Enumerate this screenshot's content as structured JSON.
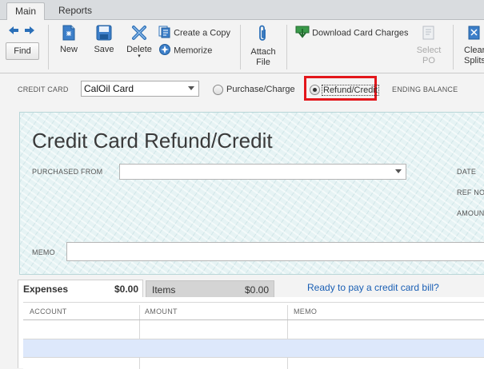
{
  "tabs": [
    {
      "label": "Main",
      "active": true
    },
    {
      "label": "Reports",
      "active": false
    }
  ],
  "toolbar": {
    "find": "Find",
    "new": "New",
    "save": "Save",
    "delete": "Delete",
    "create_copy": "Create a Copy",
    "memorize": "Memorize",
    "attach_line1": "Attach",
    "attach_line2": "File",
    "download": "Download Card Charges",
    "select_line1": "Select",
    "select_line2": "PO",
    "clear_line1": "Clear",
    "clear_line2": "Splits"
  },
  "header": {
    "credit_card_label": "CREDIT CARD",
    "credit_card_value": "CalOil Card",
    "radio_purchase": "Purchase/Charge",
    "radio_refund": "Refund/Credit",
    "selected_radio": "refund",
    "ending_balance_label": "ENDING BALANCE"
  },
  "form": {
    "title": "Credit Card Refund/Credit",
    "purchased_from_label": "PURCHASED FROM",
    "date_label": "DATE",
    "ref_label": "REF NO",
    "amount_label": "AMOUN",
    "memo_label": "MEMO"
  },
  "lower_tabs": {
    "expenses_label": "Expenses",
    "expenses_amount": "$0.00",
    "items_label": "Items",
    "items_amount": "$0.00",
    "pay_link": "Ready to pay a credit card bill?"
  },
  "grid": {
    "columns": [
      "ACCOUNT",
      "AMOUNT",
      "MEMO"
    ],
    "rows": []
  },
  "colors": {
    "highlight_box": "#e3161b",
    "icon_blue": "#2a6fb8",
    "link_blue": "#1a5fb4",
    "form_bg": "#e6f3f4",
    "row_highlight": "#dde8fb"
  }
}
